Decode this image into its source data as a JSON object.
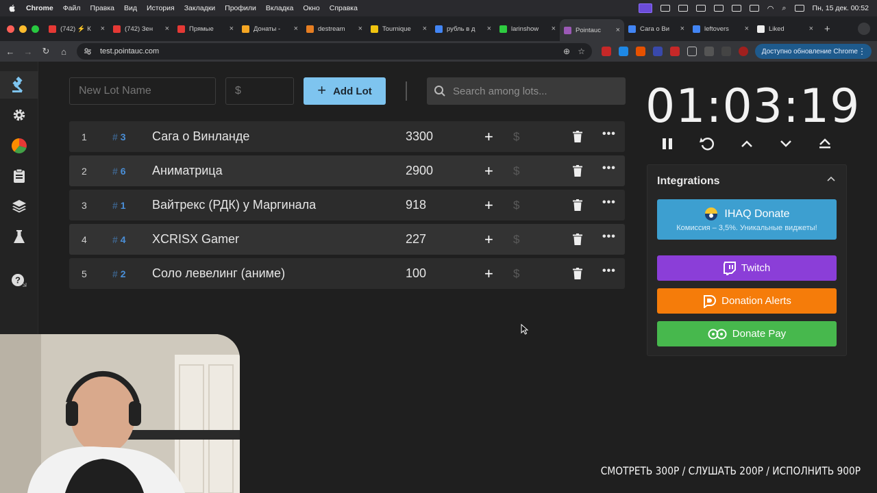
{
  "menubar": {
    "app": "Chrome",
    "items": [
      "Файл",
      "Правка",
      "Вид",
      "История",
      "Закладки",
      "Профили",
      "Вкладка",
      "Окно",
      "Справка"
    ],
    "clock": "Пн, 15 дек.  00:52"
  },
  "tabs": [
    {
      "label": "(742) ⚡ К",
      "color": "#e53935"
    },
    {
      "label": "(742) Зен",
      "color": "#e53935"
    },
    {
      "label": "Прямые",
      "color": "#e53935"
    },
    {
      "label": "Донаты -",
      "color": "#f5a623"
    },
    {
      "label": "destream",
      "color": "#e67e22"
    },
    {
      "label": "Tournique",
      "color": "#f1c40f"
    },
    {
      "label": "рубль в д",
      "color": "#4285f4"
    },
    {
      "label": "larinshow",
      "color": "#2ecc40"
    },
    {
      "label": "Pointauc",
      "color": "#9b59b6",
      "active": true
    },
    {
      "label": "Сага о Ви",
      "color": "#4285f4"
    },
    {
      "label": "leftovers",
      "color": "#4285f4"
    },
    {
      "label": "Liked",
      "color": "#eeeeee"
    }
  ],
  "url": "test.pointauc.com",
  "update_button": "Доступно обновление Chrome",
  "form": {
    "lot_name_placeholder": "New Lot Name",
    "amount_placeholder": "$",
    "add_button": "Add Lot",
    "search_placeholder": "Search among lots..."
  },
  "lots": [
    {
      "num": "1",
      "tag": "3",
      "name": "Сага о Винланде",
      "amount": "3300"
    },
    {
      "num": "2",
      "tag": "6",
      "name": "Аниматрица",
      "amount": "2900"
    },
    {
      "num": "3",
      "tag": "1",
      "name": "Вайтрекс (РДК) у Маргинала",
      "amount": "918"
    },
    {
      "num": "4",
      "tag": "4",
      "name": "XCRISX Gamer",
      "amount": "227"
    },
    {
      "num": "5",
      "tag": "2",
      "name": "Соло левелинг (аниме)",
      "amount": "100"
    }
  ],
  "timer": "01:03:19",
  "integrations": {
    "title": "Integrations",
    "donate_title": "IHAQ Donate",
    "donate_sub": "Комиссия – 3,5%. Уникальные виджеты!",
    "twitch": "Twitch",
    "alerts": "Donation Alerts",
    "pay": "Donate Pay"
  },
  "overlay": "СМОТРЕТЬ 300Р / СЛУШАТЬ 200Р / ИСПОЛНИТЬ 900Р",
  "colors": {
    "accent": "#7ec4ef",
    "twitch": "#8b3ed8",
    "alerts": "#f57c0a",
    "pay": "#47b84d",
    "donate": "#3d9fd0"
  }
}
